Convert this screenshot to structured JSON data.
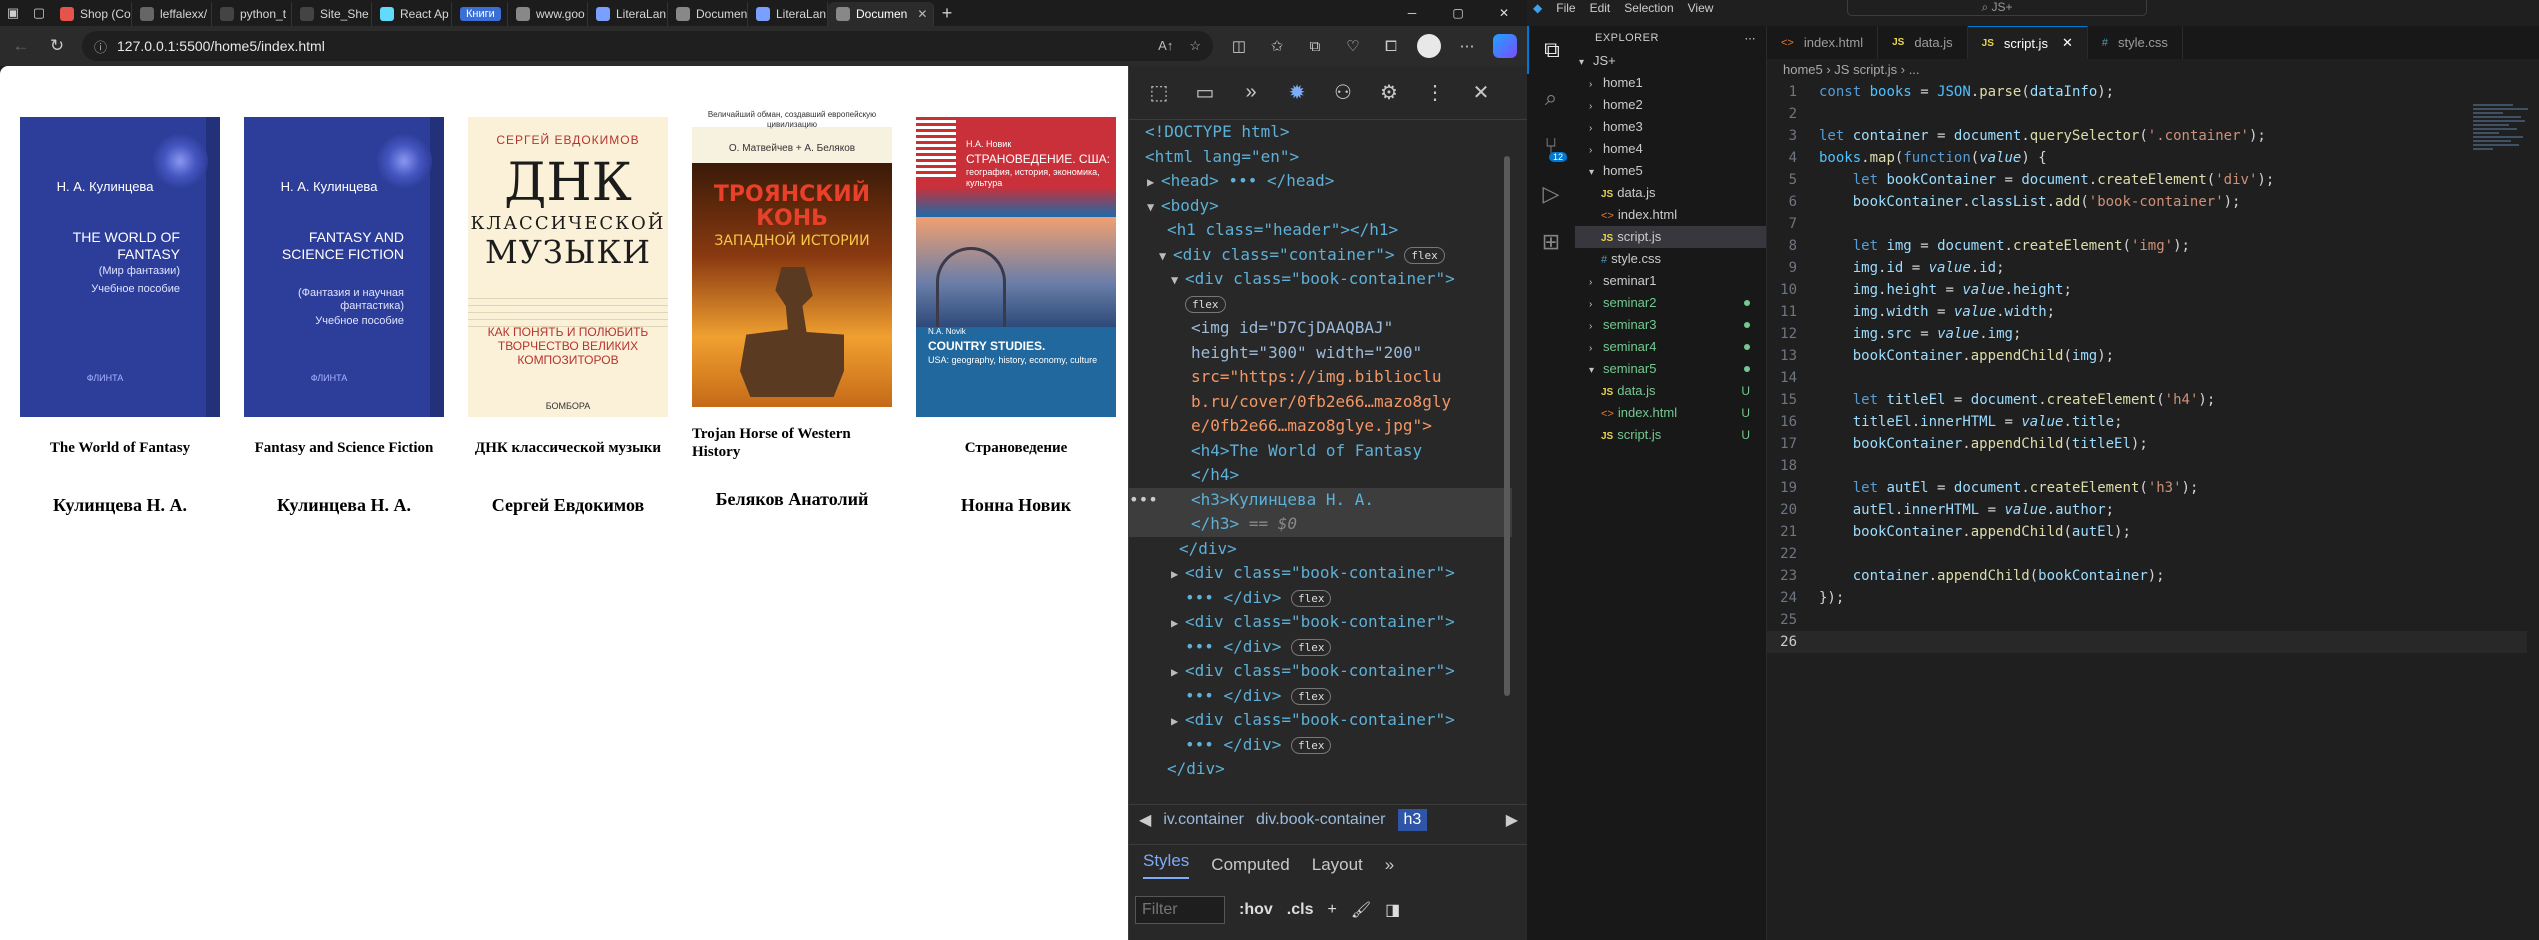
{
  "browser": {
    "tabs": [
      {
        "label": "Shop (Co",
        "fav": "#e6534b"
      },
      {
        "label": "leffalexx/",
        "fav": "#666"
      },
      {
        "label": "python_t",
        "fav": "#444"
      },
      {
        "label": "Site_She",
        "fav": "#444"
      },
      {
        "label": "React Ap",
        "fav": "#61dafb"
      },
      {
        "label": "Книги",
        "pill": true
      },
      {
        "label": "www.goo",
        "fav": "#888"
      },
      {
        "label": "LiteraLan",
        "fav": "#7aa0ff"
      },
      {
        "label": "Documen",
        "fav": "#888"
      },
      {
        "label": "LiteraLan",
        "fav": "#7aa0ff"
      },
      {
        "label": "Documen",
        "fav": "#888",
        "active": true
      }
    ],
    "url": "127.0.0.1:5500/home5/index.html"
  },
  "page": {
    "books": [
      {
        "title": "The World of Fantasy",
        "author": "Кулинцева Н. А.",
        "cover": {
          "author": "Н. А. Кулинцева",
          "title": "THE WORLD OF FANTASY",
          "sub": "(Мир фантазии)",
          "note": "Учебное пособие",
          "pub": "ФЛИНТА"
        }
      },
      {
        "title": "Fantasy and Science Fiction",
        "author": "Кулинцева Н. А.",
        "cover": {
          "author": "Н. А. Кулинцева",
          "title": "FANTASY AND SCIENCE FICTION",
          "sub": "(Фантазия и научная фантастика)",
          "note": "Учебное пособие",
          "pub": "ФЛИНТА"
        }
      },
      {
        "title": "ДНК классической музыки",
        "author": "Сергей Евдокимов",
        "cover": {
          "author": "СЕРГЕЙ ЕВДОКИМОВ",
          "big": "ДНК",
          "mid": "КЛАССИЧЕСКОЙ",
          "mus": "МУЗЫКИ",
          "desc": "КАК ПОНЯТЬ И ПОЛЮБИТЬ ТВОРЧЕСТВО ВЕЛИКИХ КОМПОЗИТОРОВ",
          "pub": "БОМБОРА"
        }
      },
      {
        "title": "Trojan Horse of Western History",
        "author": "Беляков Анатолий",
        "cover": {
          "top": "Величайший обман, создавший европейскую цивилизацию",
          "author": "О. Матвейчев + А. Беляков",
          "title": "ТРОЯНСКИЙ КОНЬ",
          "sub": "ЗАПАДНОЙ ИСТОРИИ"
        }
      },
      {
        "title": "Страноведение",
        "author": "Нонна Новик",
        "cover": {
          "author": "Н.А. Новик",
          "title": "СТРАНОВЕДЕНИЕ. США:",
          "sub": "география, история, экономика, культура",
          "en_author": "N.A. Novik",
          "en_title": "COUNTRY STUDIES.",
          "en_sub": "USA: geography, history, economy, culture"
        }
      }
    ]
  },
  "devtools": {
    "dom": [
      {
        "t": "<!DOCTYPE html>"
      },
      {
        "t": "<html lang=\"en\">"
      },
      {
        "t": "<head> ••• </head>"
      },
      {
        "t": "<body>"
      },
      {
        "t": "<h1 class=\"header\"></h1>"
      },
      {
        "t": "<div class=\"container\">",
        "badge": "flex"
      },
      {
        "t": "<div class=\"book-container\">"
      },
      {
        "t": "flex"
      },
      {
        "t": "<img id=\"D7CjDAAQBAJ\""
      },
      {
        "t": "height=\"300\" width=\"200\""
      },
      {
        "t": "src=\"https://img.biblioclu"
      },
      {
        "t": "b.ru/cover/0fb2e66…mazo8gly"
      },
      {
        "t": "e/0fb2e66…mazo8glye.jpg\">"
      },
      {
        "t": "<h4>The World of Fantasy"
      },
      {
        "t": "</h4>"
      },
      {
        "t": "<h3>Кулинцева Н. А."
      },
      {
        "t": "</h3>",
        "eq": "== $0"
      },
      {
        "t": "</div>"
      },
      {
        "t": "<div class=\"book-container\">"
      },
      {
        "t": "••• </div>",
        "badge": "flex"
      },
      {
        "t": "<div class=\"book-container\">"
      },
      {
        "t": "••• </div>",
        "badge": "flex"
      },
      {
        "t": "<div class=\"book-container\">"
      },
      {
        "t": "••• </div>",
        "badge": "flex"
      },
      {
        "t": "<div class=\"book-container\">"
      },
      {
        "t": "••• </div>",
        "badge": "flex"
      },
      {
        "t": "</div>"
      }
    ],
    "crumbs": [
      "iv.container",
      "div.book-container",
      "h3"
    ],
    "tabs": [
      "Styles",
      "Computed",
      "Layout"
    ],
    "filter_placeholder": "Filter",
    "hov": ":hov",
    "cls": ".cls"
  },
  "vscode": {
    "menu": [
      "File",
      "Edit",
      "Selection",
      "View"
    ],
    "search": "JS+",
    "explorer_title": "EXPLORER",
    "root": "JS+",
    "tree": [
      {
        "label": "home1",
        "type": "folder"
      },
      {
        "label": "home2",
        "type": "folder"
      },
      {
        "label": "home3",
        "type": "folder"
      },
      {
        "label": "home4",
        "type": "folder"
      },
      {
        "label": "home5",
        "type": "folder-open"
      },
      {
        "label": "data.js",
        "type": "js",
        "indent": 1
      },
      {
        "label": "index.html",
        "type": "html",
        "indent": 1
      },
      {
        "label": "script.js",
        "type": "js",
        "indent": 1,
        "active": true
      },
      {
        "label": "style.css",
        "type": "css",
        "indent": 1
      },
      {
        "label": "seminar1",
        "type": "folder"
      },
      {
        "label": "seminar2",
        "type": "folder",
        "status": "dot"
      },
      {
        "label": "seminar3",
        "type": "folder",
        "status": "dot"
      },
      {
        "label": "seminar4",
        "type": "folder",
        "status": "dot"
      },
      {
        "label": "seminar5",
        "type": "folder-open",
        "status": "dot"
      },
      {
        "label": "data.js",
        "type": "js",
        "indent": 1,
        "status": "U"
      },
      {
        "label": "index.html",
        "type": "html",
        "indent": 1,
        "status": "U"
      },
      {
        "label": "script.js",
        "type": "js",
        "indent": 1,
        "status": "U"
      }
    ],
    "editor_tabs": [
      {
        "label": "index.html",
        "type": "html"
      },
      {
        "label": "data.js",
        "type": "js"
      },
      {
        "label": "script.js",
        "type": "js",
        "active": true
      },
      {
        "label": "style.css",
        "type": "css"
      }
    ],
    "breadcrumb": "home5 › JS script.js › ...",
    "activity_badge": "12"
  }
}
